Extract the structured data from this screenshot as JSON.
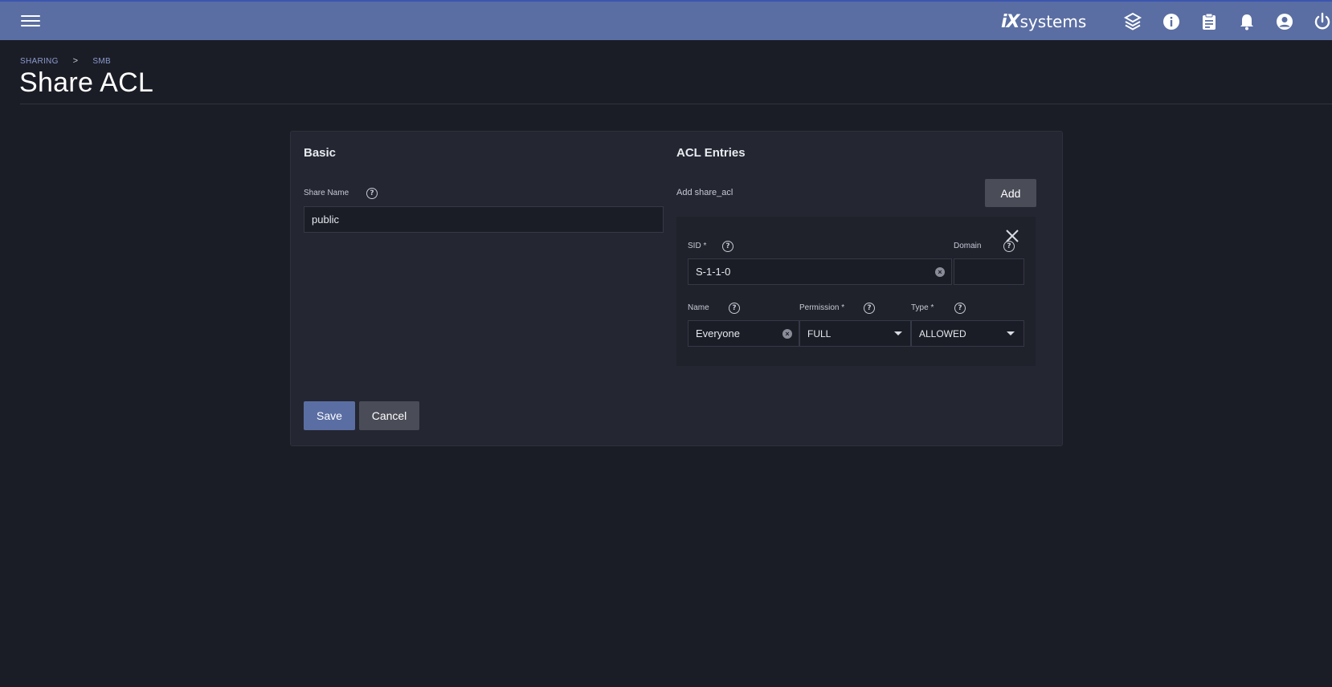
{
  "topbar": {
    "logo_ix": "iX",
    "logo_text": "systems",
    "icons": [
      "menu-icon",
      "truecommand-icon",
      "info-icon",
      "clipboard-icon",
      "bell-icon",
      "account-icon",
      "power-icon"
    ]
  },
  "breadcrumb": {
    "items": [
      "SHARING",
      "SMB"
    ],
    "separator": ">"
  },
  "page": {
    "title": "Share ACL"
  },
  "basic": {
    "title": "Basic",
    "share_name_label": "Share Name",
    "share_name_value": "public"
  },
  "acl": {
    "title": "ACL Entries",
    "add_label": "Add share_acl",
    "add_button": "Add",
    "entry": {
      "sid_label": "SID *",
      "sid_value": "S-1-1-0",
      "domain_label": "Domain",
      "domain_value": "",
      "name_label": "Name",
      "name_value": "Everyone",
      "permission_label": "Permission *",
      "permission_value": "FULL",
      "type_label": "Type *",
      "type_value": "ALLOWED"
    }
  },
  "actions": {
    "save": "Save",
    "cancel": "Cancel"
  },
  "colors": {
    "topbar": "#5a6ea3",
    "primary": "#5a6ea3",
    "background": "#1b1d26",
    "card": "#242631"
  }
}
